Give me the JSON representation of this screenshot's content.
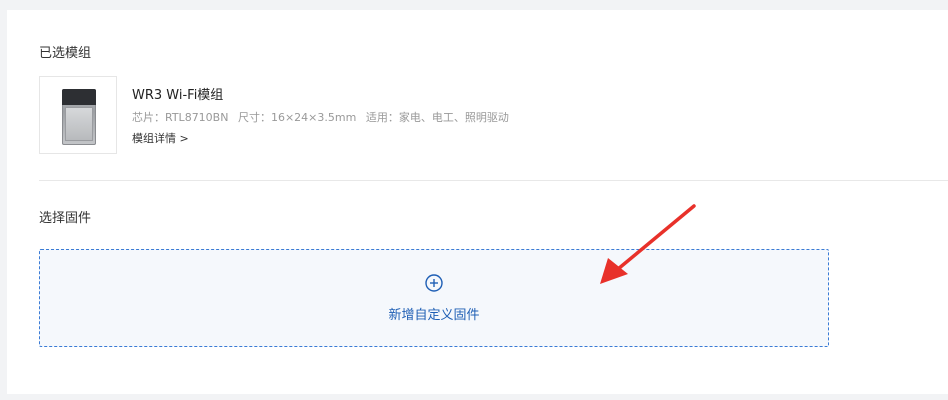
{
  "selected_module": {
    "section_title": "已选模组",
    "name": "WR3 Wi-Fi模组",
    "chip": "芯片：RTL8710BN",
    "size": "尺寸：16×24×3.5mm",
    "usage": "适用：家电、电工、照明驱动",
    "details_link": "模组详情 >"
  },
  "firmware": {
    "section_title": "选择固件",
    "add_label": "新增自定义固件",
    "add_icon": "plus-circle-icon"
  },
  "colors": {
    "accent": "#1f5fb5",
    "dashed_border": "#3a7bd5",
    "annotation_arrow": "#e8312a"
  }
}
